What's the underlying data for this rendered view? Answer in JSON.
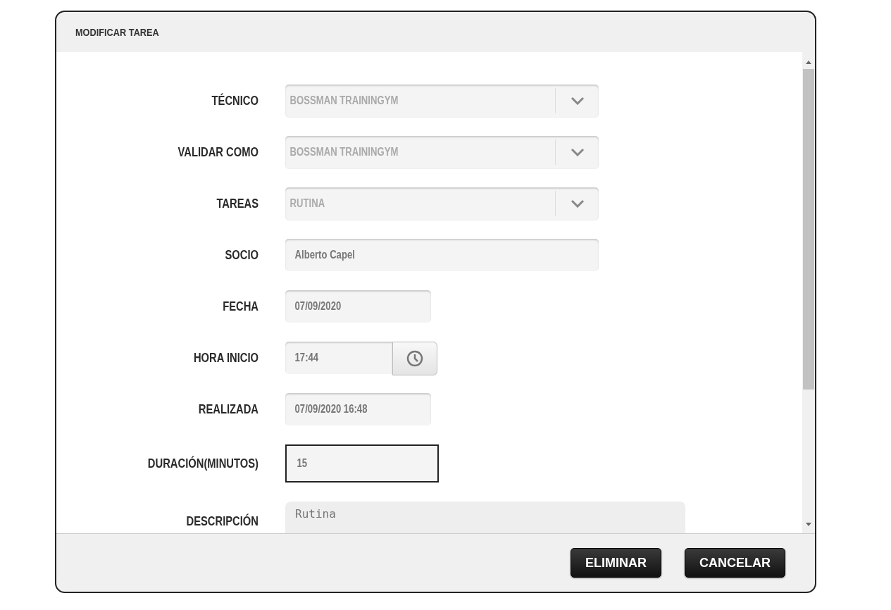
{
  "dialog": {
    "title": "MODIFICAR TAREA"
  },
  "fields": [
    {
      "label": "TÉCNICO",
      "kind": "select",
      "value": "BOSSMAN TRAININGYM",
      "focused": false
    },
    {
      "label": "VALIDAR COMO",
      "kind": "select",
      "value": "BOSSMAN TRAININGYM",
      "focused": false
    },
    {
      "label": "TAREAS",
      "kind": "select",
      "value": "RUTINA",
      "focused": false
    },
    {
      "label": "SOCIO",
      "kind": "text",
      "value": "Alberto Capel",
      "focused": false
    },
    {
      "label": "FECHA",
      "kind": "short",
      "value": "07/09/2020",
      "focused": false
    },
    {
      "label": "HORA INICIO",
      "kind": "time",
      "value": "17:44",
      "focused": false
    },
    {
      "label": "REALIZADA",
      "kind": "short",
      "value": "07/09/2020 16:48",
      "focused": false
    },
    {
      "label": "DURACIÓN(MINUTOS)",
      "kind": "short",
      "value": "15",
      "focused": true
    },
    {
      "label": "DESCRIPCIÓN",
      "kind": "textarea",
      "value": "Rutina",
      "focused": false
    }
  ],
  "buttons": [
    "ELIMINAR",
    "CANCELAR"
  ]
}
